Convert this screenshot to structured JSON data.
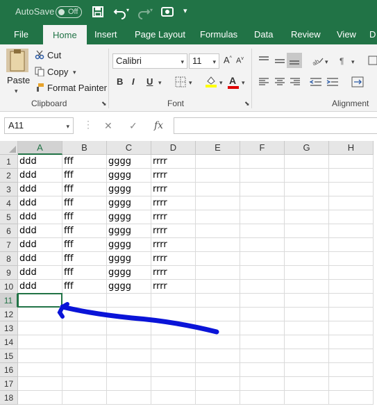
{
  "titlebar": {
    "autosave_label": "AutoSave",
    "toggle_label": "Off"
  },
  "tabs": [
    {
      "label": "File"
    },
    {
      "label": "Home"
    },
    {
      "label": "Insert"
    },
    {
      "label": "Page Layout"
    },
    {
      "label": "Formulas"
    },
    {
      "label": "Data"
    },
    {
      "label": "Review"
    },
    {
      "label": "View"
    },
    {
      "label": "D"
    }
  ],
  "ribbon": {
    "clipboard": {
      "paste": "Paste",
      "cut": "Cut",
      "copy": "Copy",
      "format_painter": "Format Painter",
      "group_label": "Clipboard"
    },
    "font": {
      "family": "Calibri",
      "size": "11",
      "bold": "B",
      "italic": "I",
      "underline": "U",
      "group_label": "Font"
    },
    "alignment": {
      "group_label": "Alignment"
    }
  },
  "formula_bar": {
    "name_box": "A11",
    "formula": ""
  },
  "sheet": {
    "columns": [
      "A",
      "B",
      "C",
      "D",
      "E",
      "F",
      "G",
      "H"
    ],
    "row_numbers": [
      "1",
      "2",
      "3",
      "4",
      "5",
      "6",
      "7",
      "8",
      "9",
      "10",
      "11",
      "12",
      "13",
      "14",
      "15",
      "16",
      "17",
      "18"
    ],
    "rows": [
      [
        "ddd",
        "fff",
        "gggg",
        "rrrr"
      ],
      [
        "ddd",
        "fff",
        "gggg",
        "rrrr"
      ],
      [
        "ddd",
        "fff",
        "gggg",
        "rrrr"
      ],
      [
        "ddd",
        "fff",
        "gggg",
        "rrrr"
      ],
      [
        "ddd",
        "fff",
        "gggg",
        "rrrr"
      ],
      [
        "ddd",
        "fff",
        "gggg",
        "rrrr"
      ],
      [
        "ddd",
        "fff",
        "gggg",
        "rrrr"
      ],
      [
        "ddd",
        "fff",
        "gggg",
        "rrrr"
      ],
      [
        "ddd",
        "fff",
        "gggg",
        "rrrr"
      ],
      [
        "ddd",
        "fff",
        "gggg",
        "rrrr"
      ]
    ],
    "selected_cell": "A11"
  },
  "colors": {
    "excel_green": "#217346",
    "annotation_arrow": "#0a14d8",
    "font_highlight": "#ffff00",
    "font_color": "#e00000"
  }
}
